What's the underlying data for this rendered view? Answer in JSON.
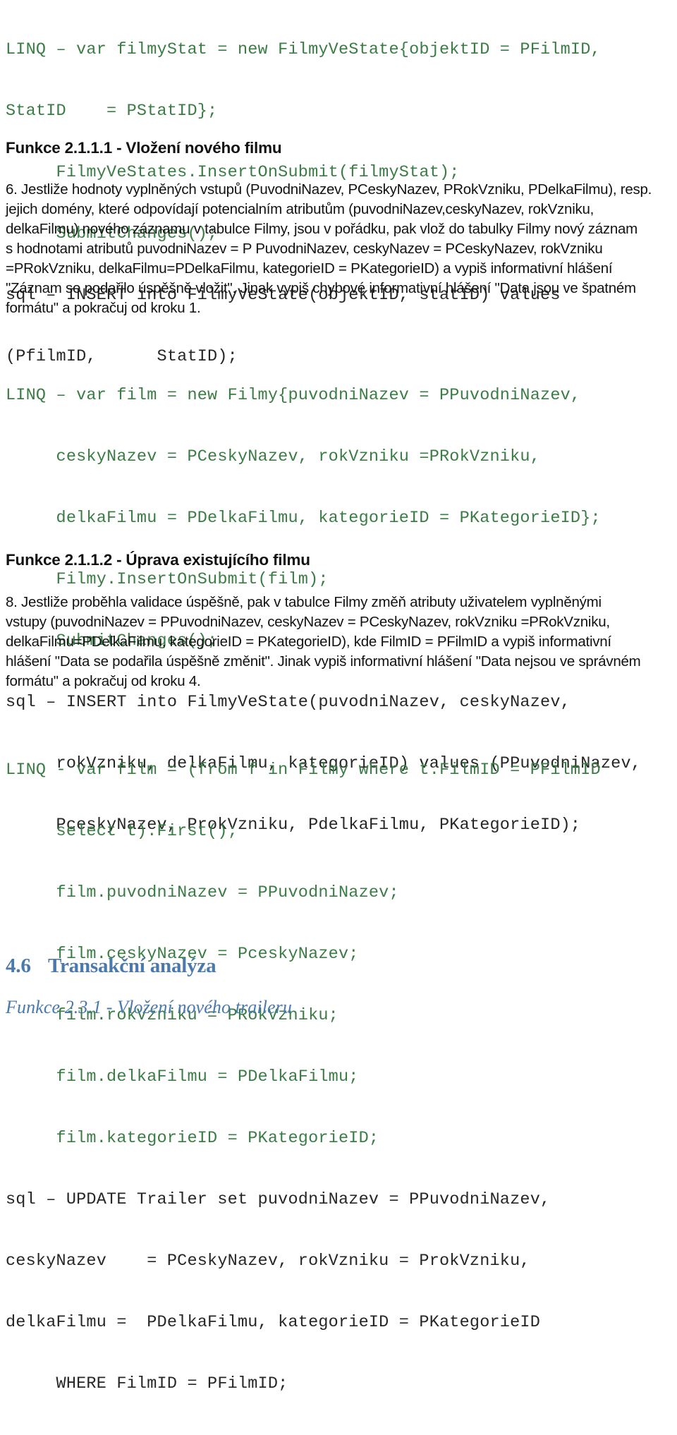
{
  "document": {
    "language": "cs",
    "colors": {
      "code_green": "#3a7d44",
      "code_dark": "#262626",
      "heading_blue": "#4a79ad",
      "body_text": "#121212",
      "background": "#ffffff"
    }
  },
  "code_block_1": {
    "lines": [
      {
        "text": "LINQ – var filmyStat = new FilmyVeState{objektID = PFilmID,",
        "color": "green"
      },
      {
        "text": "StatID    = PStatID};",
        "color": "green"
      },
      {
        "text": "     FilmyVeStates.InsertOnSubmit(filmyStat);",
        "color": "green"
      },
      {
        "text": "     SubmitChanges();",
        "color": "green"
      },
      {
        "text": "sql – INSERT into FilmyVeState(objektID, statID) values",
        "color": "dark"
      },
      {
        "text": "(PfilmID,      StatID);",
        "color": "dark"
      }
    ]
  },
  "heading_1": {
    "text": "Funkce 2.1.1.1 - Vložení nového filmu"
  },
  "paragraph_1": {
    "lines": [
      "6. Jestliže hodnoty vyplněných vstupů (PuvodniNazev, PCeskyNazev, PRokVzniku, PDelkaFilmu), resp.",
      "jejich domény, které odpovídají potencialním atributům (puvodniNazev,ceskyNazev, rokVzniku,",
      "delkaFilmu) nového záznamu v tabulce Filmy, jsou v pořádku, pak vlož do tabulky Filmy nový záznam",
      "s hodnotami atributů puvodniNazev = P PuvodniNazev, ceskyNazev = PCeskyNazev, rokVzniku",
      "=PRokVzniku, delkaFilmu=PDelkaFilmu, kategorieID = PKategorieID) a vypiš informativní hlášení",
      "\"Záznam se podařilo úspěšně vložit\". Jinak vypiš chybové informativní hlášení \"Data jsou ve špatném",
      "formátu\" a pokračuj od kroku 1."
    ]
  },
  "code_block_2": {
    "lines": [
      {
        "text": "LINQ – var film = new Filmy{puvodniNazev = PPuvodniNazev,",
        "color": "green"
      },
      {
        "text": "     ceskyNazev = PCeskyNazev, rokVzniku =PRokVzniku,",
        "color": "green"
      },
      {
        "text": "     delkaFilmu = PDelkaFilmu, kategorieID = PKategorieID};",
        "color": "green"
      },
      {
        "text": "     Filmy.InsertOnSubmit(film);",
        "color": "green"
      },
      {
        "text": "     SubmitChanges();",
        "color": "green"
      },
      {
        "text": "sql – INSERT into FilmyVeState(puvodniNazev, ceskyNazev,",
        "color": "dark"
      },
      {
        "text": "     rokVzniku, delkaFilmu, kategorieID) values (PPuvodniNazev,",
        "color": "dark"
      },
      {
        "text": "     PceskyNazev, ProkVzniku, PdelkaFilmu, PKategorieID);",
        "color": "dark"
      }
    ]
  },
  "heading_2": {
    "text": "Funkce 2.1.1.2 - Úprava existujícího filmu"
  },
  "paragraph_2": {
    "lines": [
      "8. Jestliže proběhla validace úspěšně, pak v tabulce Filmy změň atributy uživatelem vyplněnými",
      "vstupy (puvodniNazev = PPuvodniNazev, ceskyNazev = PCeskyNazev, rokVzniku =PRokVzniku,",
      "delkaFilmu=PDelkaFilmu, kategorieID = PKategorieID), kde FilmID = PFilmID a vypiš informativní",
      "hlášení \"Data se podařila úspěšně změnit\". Jinak vypiš informativní hlášení \"Data nejsou ve správném",
      "formátu\" a pokračuj od kroku 4."
    ]
  },
  "code_block_3": {
    "lines": [
      {
        "text": "LINQ - var film = (from f in Filmy where t.FilmID = PFilmID",
        "color": "green"
      },
      {
        "text": "     select t).First();",
        "color": "green"
      },
      {
        "text": "     film.puvodniNazev = PPuvodniNazev;",
        "color": "green"
      },
      {
        "text": "     film.ceskyNazev = PceskyNazev;",
        "color": "green"
      },
      {
        "text": "     film.rokVzniku = PRokVzniku;",
        "color": "green"
      },
      {
        "text": "     film.delkaFilmu = PDelkaFilmu;",
        "color": "green"
      },
      {
        "text": "     film.kategorieID = PKategorieID;",
        "color": "green"
      },
      {
        "text": "sql – UPDATE Trailer set puvodniNazev = PPuvodniNazev,",
        "color": "dark"
      },
      {
        "text": "ceskyNazev    = PCeskyNazev, rokVzniku = ProkVzniku,",
        "color": "dark"
      },
      {
        "text": "delkaFilmu =  PDelkaFilmu, kategorieID = PKategorieID",
        "color": "dark"
      },
      {
        "text": "     WHERE FilmID = PFilmID;",
        "color": "dark"
      }
    ]
  },
  "section_heading": {
    "number": "4.6",
    "title": "Transakční analýza"
  },
  "subheading_italic": {
    "text": "Funkce 2.3.1 - Vložení nového traileru"
  }
}
